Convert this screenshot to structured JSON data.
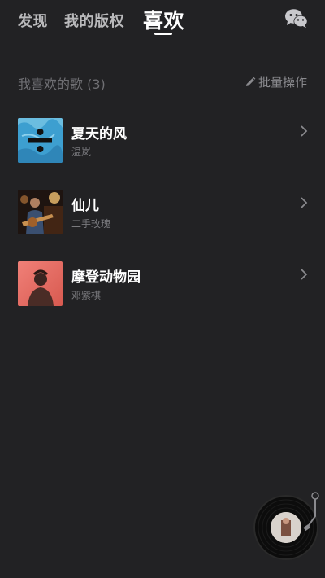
{
  "nav": {
    "tabs": [
      {
        "label": "发现"
      },
      {
        "label": "我的版权"
      },
      {
        "label": "喜欢"
      }
    ],
    "active_tab": "喜欢",
    "share_icon": "wechat-icon"
  },
  "section": {
    "title": "我喜欢的歌 (3)",
    "batch_label": "批量操作",
    "batch_icon": "pencil-icon"
  },
  "songs": [
    {
      "title": "夏天的风",
      "artist": "温岚",
      "cover_icon": "album-cover-divide-icon"
    },
    {
      "title": "仙儿",
      "artist": "二手玫瑰",
      "cover_icon": "album-cover-guitarist-icon"
    },
    {
      "title": "摩登动物园",
      "artist": "邓紫棋",
      "cover_icon": "album-cover-portrait-icon"
    }
  ],
  "player": {
    "icon": "vinyl-disc-icon"
  },
  "colors": {
    "background": "#222224",
    "active_text": "#ffffff",
    "inactive_text": "#b9b9bb",
    "secondary_text": "#7a7a7e"
  }
}
